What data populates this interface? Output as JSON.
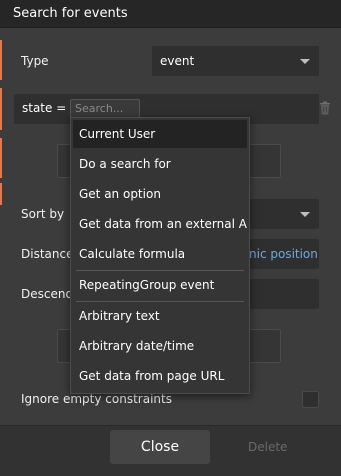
{
  "window": {
    "title": "Search for events"
  },
  "type_row": {
    "label": "Type",
    "value": "event"
  },
  "constraint": {
    "key": "state =",
    "search_placeholder": "Search..."
  },
  "sort_row": {
    "label": "Sort by"
  },
  "distance_row": {
    "label": "Distance",
    "link_text": "nic position"
  },
  "descending_row": {
    "label": "Descend"
  },
  "ignore_row": {
    "label": "Ignore empty constraints"
  },
  "footer": {
    "close_label": "Close",
    "delete_label": "Delete"
  },
  "dropdown": {
    "items": [
      "Current User",
      "Do a search for",
      "Get an option",
      "Get data from an external API",
      "Calculate formula",
      "RepeatingGroup event",
      "Arbitrary text",
      "Arbitrary date/time",
      "Get data from page URL"
    ],
    "highlighted": "Current User"
  },
  "colors": {
    "accent": "#e4794f",
    "link": "#6fa8dc",
    "panel": "#3c3c3c"
  }
}
